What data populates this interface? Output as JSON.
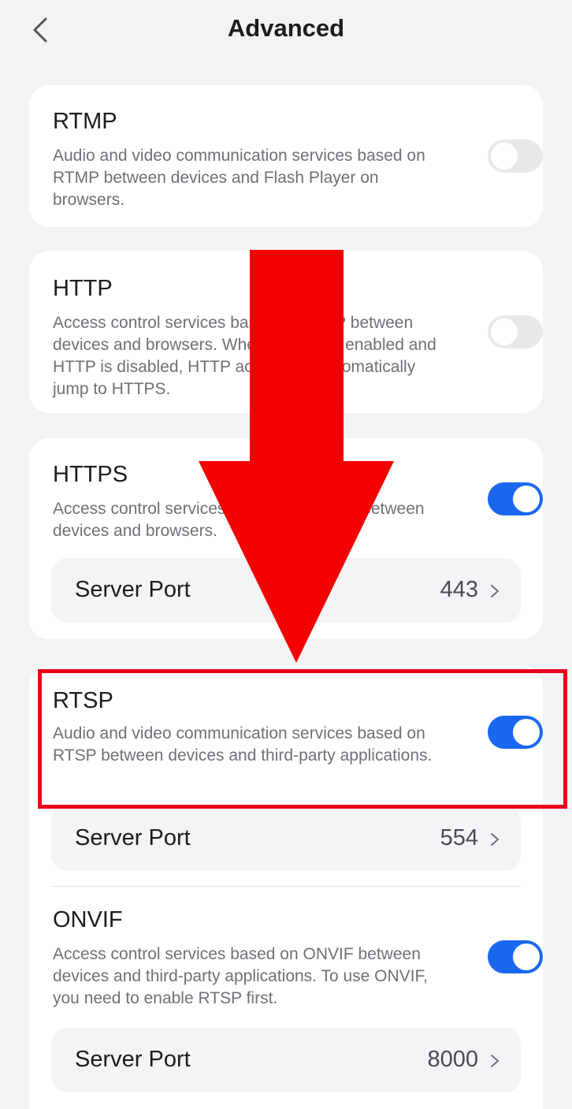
{
  "header": {
    "title": "Advanced",
    "back_icon": "chevron-left-icon"
  },
  "sections": [
    {
      "title": "RTMP",
      "description": "Audio and video communication services based on RTMP between devices and Flash Player on browsers.",
      "enabled": false
    },
    {
      "title": "HTTP",
      "description": "Access control services based on HTTP between devices and browsers. When HTTPS is enabled and HTTP is disabled, HTTP access will automatically jump to HTTPS.",
      "enabled": false
    },
    {
      "title": "HTTPS",
      "description": "Access control services based on HTTPS between devices and browsers.",
      "enabled": true,
      "port_label": "Server Port",
      "port_value": "443"
    },
    {
      "title": "RTSP",
      "description": "Audio and video communication services based on RTSP between devices and third-party applications.",
      "enabled": true,
      "port_label": "Server Port",
      "port_value": "554"
    },
    {
      "title": "ONVIF",
      "description": "Access control services based on ONVIF between devices and third-party applications. To use ONVIF, you need to enable RTSP first.",
      "enabled": true,
      "port_label": "Server Port",
      "port_value": "8000"
    }
  ],
  "overlay": {
    "arrow_color": "#f50000",
    "highlight_color": "#e8001c"
  },
  "colors": {
    "toggle_on": "#1a68ef",
    "toggle_off": "#e8e8ea",
    "background": "#f2f3f5"
  }
}
